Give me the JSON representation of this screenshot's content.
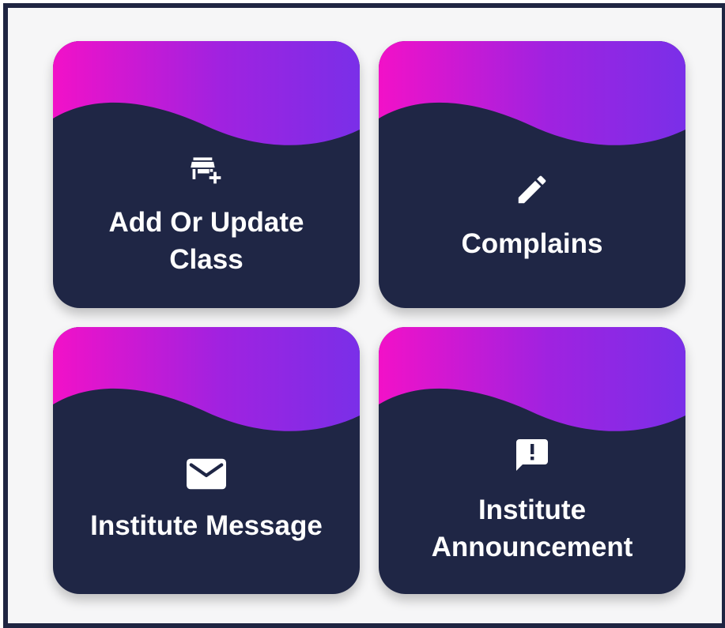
{
  "colors": {
    "frame_border": "#1f2542",
    "card_background": "#1f2645",
    "gradient_start": "#f211c8",
    "gradient_end": "#7a2fe8",
    "text": "#ffffff"
  },
  "cards": [
    {
      "label": "Add Or Update\nClass",
      "icon": "add-store-icon"
    },
    {
      "label": "Complains",
      "icon": "pencil-icon"
    },
    {
      "label": "Institute Message",
      "icon": "envelope-icon"
    },
    {
      "label": "Institute\nAnnouncement",
      "icon": "announcement-icon"
    }
  ]
}
